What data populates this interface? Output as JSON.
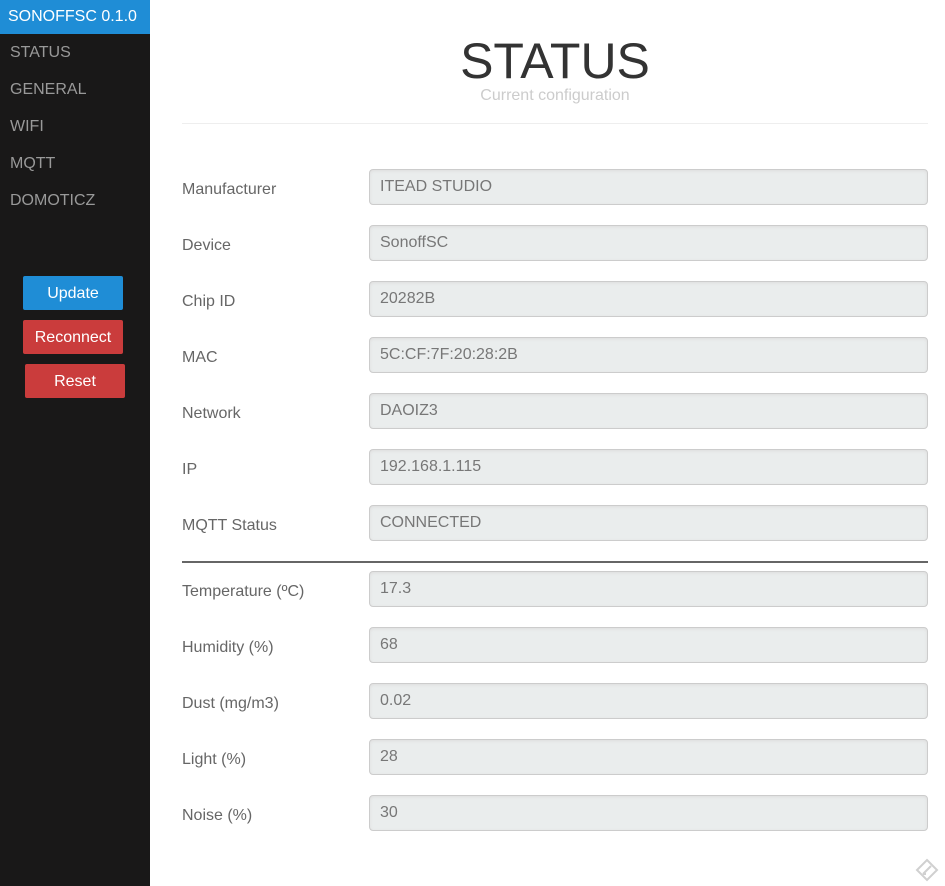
{
  "sidebar": {
    "brand": "SONOFFSC 0.1.0",
    "items": [
      {
        "label": "STATUS"
      },
      {
        "label": "GENERAL"
      },
      {
        "label": "WIFI"
      },
      {
        "label": "MQTT"
      },
      {
        "label": "DOMOTICZ"
      }
    ],
    "buttons": {
      "update": "Update",
      "reconnect": "Reconnect",
      "reset": "Reset"
    }
  },
  "header": {
    "title": "STATUS",
    "subtitle": "Current configuration"
  },
  "status_fields": [
    {
      "label": "Manufacturer",
      "value": "ITEAD STUDIO"
    },
    {
      "label": "Device",
      "value": "SonoffSC"
    },
    {
      "label": "Chip ID",
      "value": "20282B"
    },
    {
      "label": "MAC",
      "value": "5C:CF:7F:20:28:2B"
    },
    {
      "label": "Network",
      "value": "DAOIZ3"
    },
    {
      "label": "IP",
      "value": "192.168.1.115"
    },
    {
      "label": "MQTT Status",
      "value": "CONNECTED"
    }
  ],
  "sensor_fields": [
    {
      "label": "Temperature (ºC)",
      "value": "17.3"
    },
    {
      "label": "Humidity (%)",
      "value": "68"
    },
    {
      "label": "Dust (mg/m3)",
      "value": "0.02"
    },
    {
      "label": "Light (%)",
      "value": "28"
    },
    {
      "label": "Noise (%)",
      "value": "30"
    }
  ],
  "colors": {
    "sidebar_bg": "#191818",
    "accent": "#1f8dd6",
    "danger": "#ca3c3c",
    "field_bg": "#eaeded"
  },
  "icons": {
    "corner": "edit-pencil-icon"
  }
}
